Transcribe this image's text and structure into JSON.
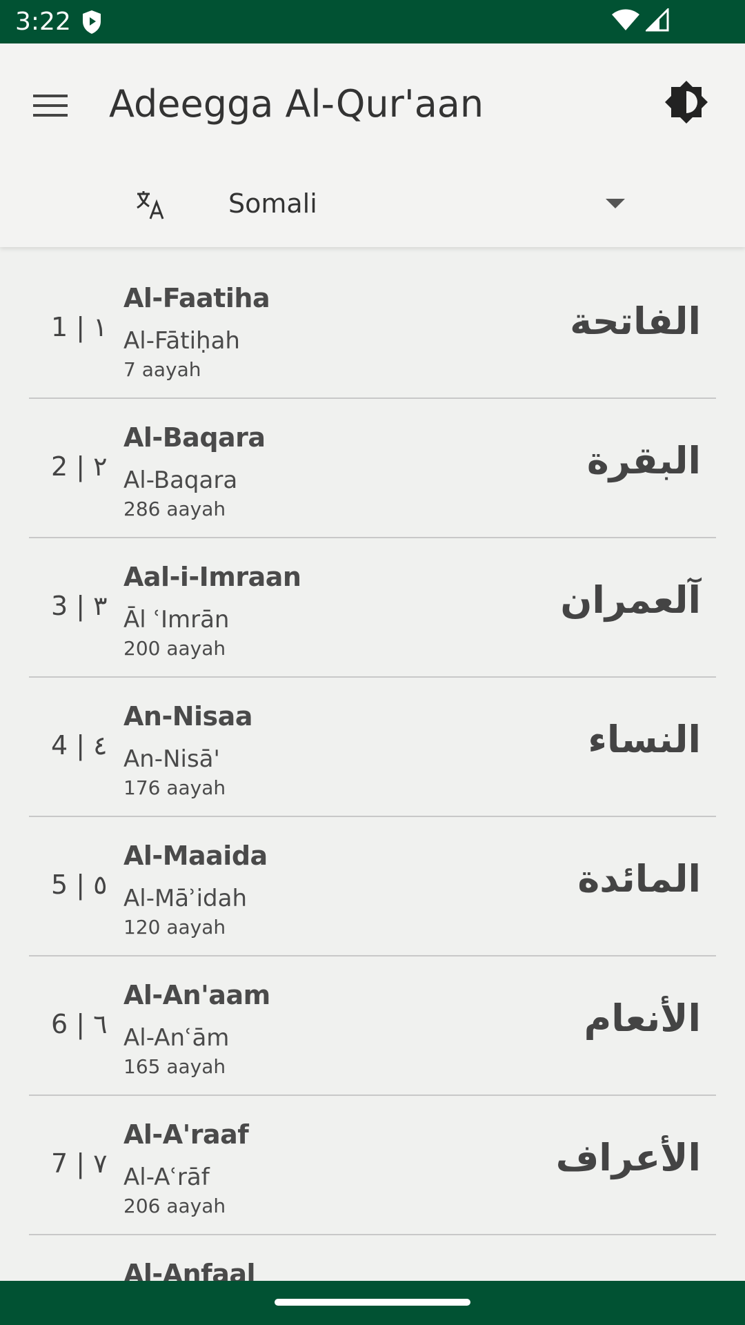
{
  "status_bar": {
    "time": "3:22"
  },
  "app_bar": {
    "title": "Adeegga Al-Qur'aan",
    "language_label": "Somali"
  },
  "surahs": [
    {
      "number": "1 | ١",
      "name": "Al-Faatiha",
      "translit": "Al-Fātiḥah",
      "verses": "7 aayah",
      "arabic": "الفاتحة"
    },
    {
      "number": "2 | ٢",
      "name": "Al-Baqara",
      "translit": "Al-Baqara",
      "verses": "286 aayah",
      "arabic": "البقرة"
    },
    {
      "number": "3 | ٣",
      "name": "Aal-i-Imraan",
      "translit": "Āl ʿImrān",
      "verses": "200 aayah",
      "arabic": "آلعمران"
    },
    {
      "number": "4 | ٤",
      "name": "An-Nisaa",
      "translit": "An-Nisā'",
      "verses": "176 aayah",
      "arabic": "النساء"
    },
    {
      "number": "5 | ٥",
      "name": "Al-Maaida",
      "translit": "Al-Māʾidah",
      "verses": "120 aayah",
      "arabic": "المائدة"
    },
    {
      "number": "6 | ٦",
      "name": "Al-An'aam",
      "translit": "Al-Anʿām",
      "verses": "165 aayah",
      "arabic": "الأنعام"
    },
    {
      "number": "7 | ٧",
      "name": "Al-A'raaf",
      "translit": "Al-Aʿrāf",
      "verses": "206 aayah",
      "arabic": "الأعراف"
    },
    {
      "number": "",
      "name": "Al-Anfaal",
      "translit": "",
      "verses": "",
      "arabic": ""
    }
  ],
  "colors": {
    "primary_dark": "#015233",
    "background": "#f0f1ef"
  },
  "icons": {
    "menu": "menu-icon",
    "theme": "brightness-icon",
    "translate": "translate-icon",
    "dropdown": "dropdown-arrow-icon",
    "shield": "shield-icon",
    "wifi": "wifi-icon",
    "signal": "signal-icon"
  }
}
